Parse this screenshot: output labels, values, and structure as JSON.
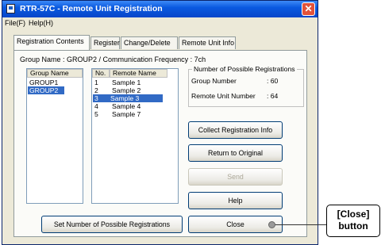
{
  "window": {
    "title": "RTR-57C - Remote Unit Registration",
    "close_glyph": "✕"
  },
  "menu": {
    "file": "File(F)",
    "help": "Help(H)"
  },
  "tabs": [
    {
      "label": "Registration Contents"
    },
    {
      "label": "Register"
    },
    {
      "label": "Change/Delete"
    },
    {
      "label": "Remote Unit Info"
    }
  ],
  "group_info": "Group Name : GROUP2 / Communication Frequency : 7ch",
  "group_list": {
    "header": "Group Name",
    "items": [
      "GROUP1",
      "GROUP2"
    ],
    "selected": "GROUP2"
  },
  "remote_list": {
    "headers": [
      "No.",
      "Remote Name"
    ],
    "rows": [
      {
        "no": "1",
        "name": "Sample 1"
      },
      {
        "no": "2",
        "name": "Sample 2"
      },
      {
        "no": "3",
        "name": "Sample 3"
      },
      {
        "no": "4",
        "name": "Sample 4"
      },
      {
        "no": "5",
        "name": "Sample 7"
      }
    ],
    "selected_no": "3"
  },
  "possible_registrations": {
    "legend": "Number of Possible Registrations",
    "group_number_label": "Group Number",
    "group_number_value": ": 60",
    "remote_unit_number_label": "Remote Unit Number",
    "remote_unit_number_value": ": 64"
  },
  "buttons": {
    "collect": "Collect Registration Info",
    "return": "Return to Original",
    "send": "Send",
    "help": "Help",
    "set_number": "Set Number of Possible Registrations",
    "close": "Close"
  },
  "callout": {
    "line1": "[Close]",
    "line2": "button"
  }
}
